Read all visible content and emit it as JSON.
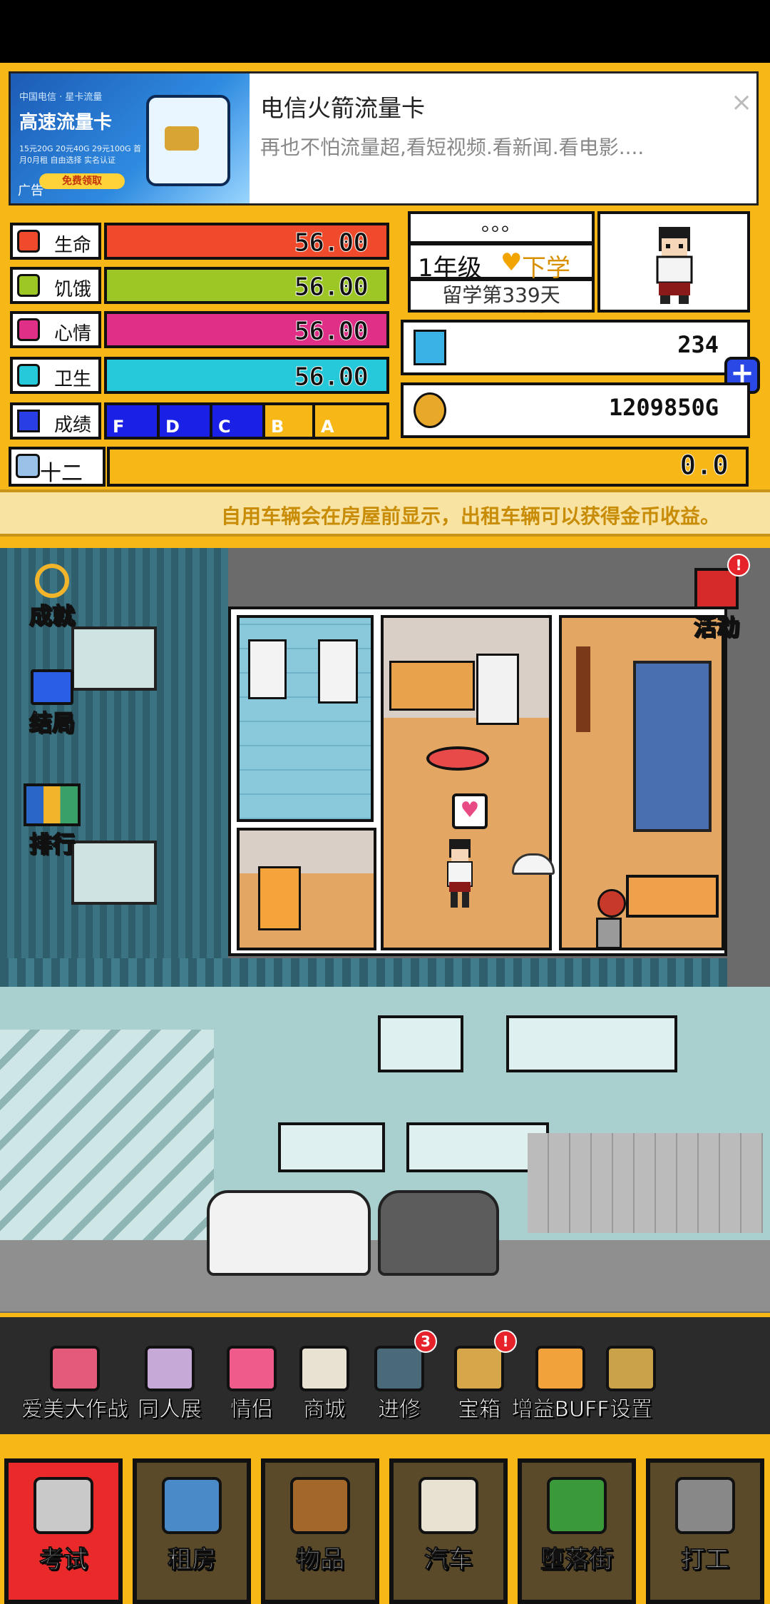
{
  "ad": {
    "image_subtitle": "中国电信 · 星卡流量",
    "image_title": "高速流量卡",
    "image_fine_print": "15元20G 20元40G 29元100G 首月0月租 自由选择 实名认证",
    "image_button": "免费领取",
    "tag": "广告",
    "title": "电信火箭流量卡",
    "description": "再也不怕流量超,看短视频.看新闻.看电影....",
    "close": "×"
  },
  "stats": [
    {
      "label": "生命",
      "value": "56.00",
      "color": "#f04a2c",
      "icon": "heart-life-icon"
    },
    {
      "label": "饥饿",
      "value": "56.00",
      "color": "#9dc725",
      "icon": "food-icon"
    },
    {
      "label": "心情",
      "value": "56.00",
      "color": "#df2f86",
      "icon": "music-note-icon"
    },
    {
      "label": "卫生",
      "value": "56.00",
      "color": "#25c9da",
      "icon": "water-drop-icon"
    }
  ],
  "grades": {
    "label": "成绩",
    "cells": [
      "F",
      "D",
      "C",
      "B",
      "A"
    ],
    "filled_color": "#1b20e6",
    "empty_color": "#f7b717"
  },
  "status": {
    "dots": "。。。",
    "grade_year": "1年级",
    "semester": "下学期",
    "days": "留学第339天"
  },
  "currency": {
    "gems": "234",
    "gold": "1209850G",
    "plus": "+"
  },
  "month": {
    "label": "十二月",
    "value": "0.0"
  },
  "ticker": "自用车辆会在房屋前显示，出租车辆可以获得金币收益。",
  "scene": {
    "achievements": "成就",
    "endings": "结局",
    "ranking": "排行",
    "activity": "活动",
    "activity_badge": "!",
    "heart": "♥"
  },
  "toolbar": [
    {
      "label": "爱美大作战",
      "icon": "beauty-lips-icon",
      "color": "#e45a7a"
    },
    {
      "label": "同人展",
      "icon": "comic-exhibition-icon",
      "color": "#c7a9d8"
    },
    {
      "label": "情侣",
      "icon": "couple-hearts-icon",
      "color": "#ef5b8a"
    },
    {
      "label": "商城",
      "icon": "shop-icon",
      "color": "#e8e2d2"
    },
    {
      "label": "进修",
      "icon": "study-tools-icon",
      "color": "#4a6a7a",
      "badge": "3"
    },
    {
      "label": "宝箱",
      "icon": "treasure-chest-icon",
      "color": "#d6a64a",
      "badge": "!"
    },
    {
      "label": "增益BUFF",
      "icon": "buff-boost-icon",
      "color": "#f2a23a"
    },
    {
      "label": "设置",
      "icon": "gear-icon",
      "color": "#c9a24a"
    }
  ],
  "nav": [
    {
      "label": "考试",
      "icon": "exam-building-icon",
      "active": true
    },
    {
      "label": "租房",
      "icon": "rent-crystal-icon",
      "active": false
    },
    {
      "label": "物品",
      "icon": "items-bag-icon",
      "active": false
    },
    {
      "label": "汽车",
      "icon": "car-wheel-icon",
      "active": false
    },
    {
      "label": "堕落街",
      "icon": "bottle-icon",
      "active": false
    },
    {
      "label": "打工",
      "icon": "cash-register-icon",
      "active": false
    }
  ]
}
